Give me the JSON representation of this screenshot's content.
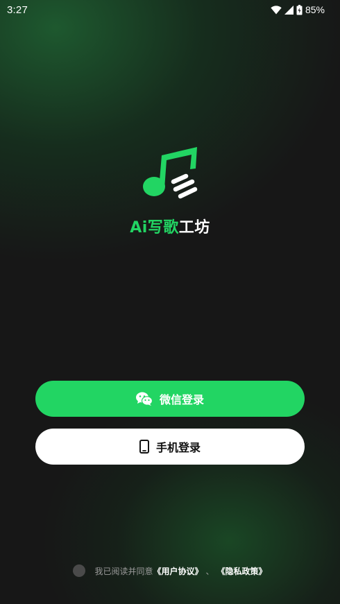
{
  "status_bar": {
    "time": "3:27",
    "battery": "85%",
    "icons": [
      "wifi-icon",
      "signal-icon",
      "battery-icon"
    ]
  },
  "app": {
    "name_accent": "Ai写歌",
    "name_rest": "工坊",
    "logo_icon": "music-note-icon",
    "accent_color": "#22d563"
  },
  "buttons": {
    "wechat_label": "微信登录",
    "wechat_icon": "wechat-icon",
    "phone_label": "手机登录",
    "phone_icon": "phone-icon"
  },
  "agreement": {
    "prefix": "我已阅读并同意",
    "user_agreement": "《用户协议》",
    "separator": "、",
    "privacy_policy": "《隐私政策》"
  }
}
